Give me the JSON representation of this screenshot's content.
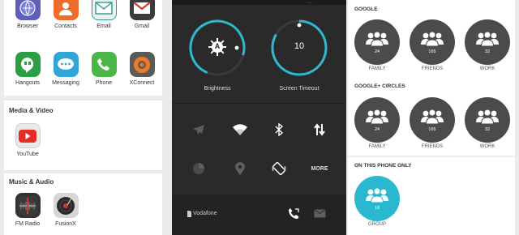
{
  "left": {
    "top_apps": [
      {
        "label": "Browser",
        "icon": "browser-icon",
        "color": "#5d5fb8"
      },
      {
        "label": "Contacts",
        "icon": "contacts-icon",
        "color": "#f06c2d"
      },
      {
        "label": "Email",
        "icon": "email-icon",
        "color": "#2f9a8a"
      },
      {
        "label": "Gmail",
        "icon": "gmail-icon",
        "color": "#cf3a30"
      },
      {
        "label": "Hangouts",
        "icon": "hangouts-icon",
        "color": "#2c9f45"
      },
      {
        "label": "Messaging",
        "icon": "messaging-icon",
        "color": "#2fa5d8"
      },
      {
        "label": "Phone",
        "icon": "phone-icon",
        "color": "#4cb648"
      },
      {
        "label": "XConnect",
        "icon": "xconnect-icon",
        "color": "#6b6b6b"
      }
    ],
    "media_video": {
      "title": "Media & Video",
      "apps": [
        {
          "label": "YouTube",
          "icon": "youtube-icon",
          "color": "#e52d27"
        }
      ]
    },
    "music_audio": {
      "title": "Music & Audio",
      "apps": [
        {
          "label": "FM Radio",
          "icon": "fm-radio-icon",
          "color": "#c93a2f"
        },
        {
          "label": "FusionX",
          "icon": "fusionx-icon",
          "color": "#d0d0d0"
        }
      ]
    }
  },
  "quick_settings": {
    "brightness": {
      "label": "Brightness",
      "badge": "A"
    },
    "screen_timeout": {
      "label": "Screen Timeout",
      "value": "10"
    },
    "more_label": "MORE",
    "carrier": "Vodafone",
    "accent_color": "#2fb8cf"
  },
  "right": {
    "google": {
      "title": "GOOGLE",
      "groups": [
        {
          "count": "24",
          "label": "FAMILY"
        },
        {
          "count": "165",
          "label": "FRIENDS"
        },
        {
          "count": "32",
          "label": "WORK"
        }
      ]
    },
    "circles": {
      "title": "GOOGLE+ CIRCLES",
      "groups": [
        {
          "count": "24",
          "label": "FAMILY"
        },
        {
          "count": "165",
          "label": "FRIENDS"
        },
        {
          "count": "32",
          "label": "WORK"
        }
      ]
    },
    "phone_only": {
      "title": "ON THIS PHONE ONLY",
      "groups": [
        {
          "count": "18",
          "label": "GROUP"
        }
      ]
    }
  }
}
